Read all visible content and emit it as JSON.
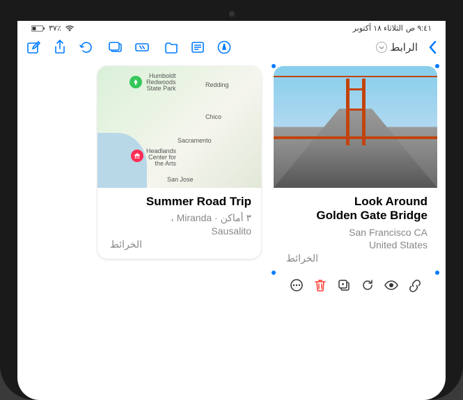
{
  "status": {
    "time": "٩:٤١ ص",
    "date": "الثلاثاء ١٨ أكتوبر",
    "battery": "٪٣٧"
  },
  "nav": {
    "tab_label": "الرابط"
  },
  "cards": [
    {
      "title": "Look Around\nGolden Gate Bridge",
      "subtitle1": "San Francisco CA",
      "subtitle2": "United States",
      "source": "الخرائط"
    },
    {
      "title": "Summer Road Trip",
      "subtitle1": "٣ أماكن · Miranda ،",
      "subtitle2": "Sausalito",
      "source": "الخرائط"
    }
  ],
  "map_labels": {
    "humboldt": "Humboldt\nRedwoods\nState Park",
    "redding": "Redding",
    "chico": "Chico",
    "sacramento": "Sacramento",
    "headlands": "Headlands\nCenter for\nthe Arts",
    "sanjose": "San Jose"
  }
}
